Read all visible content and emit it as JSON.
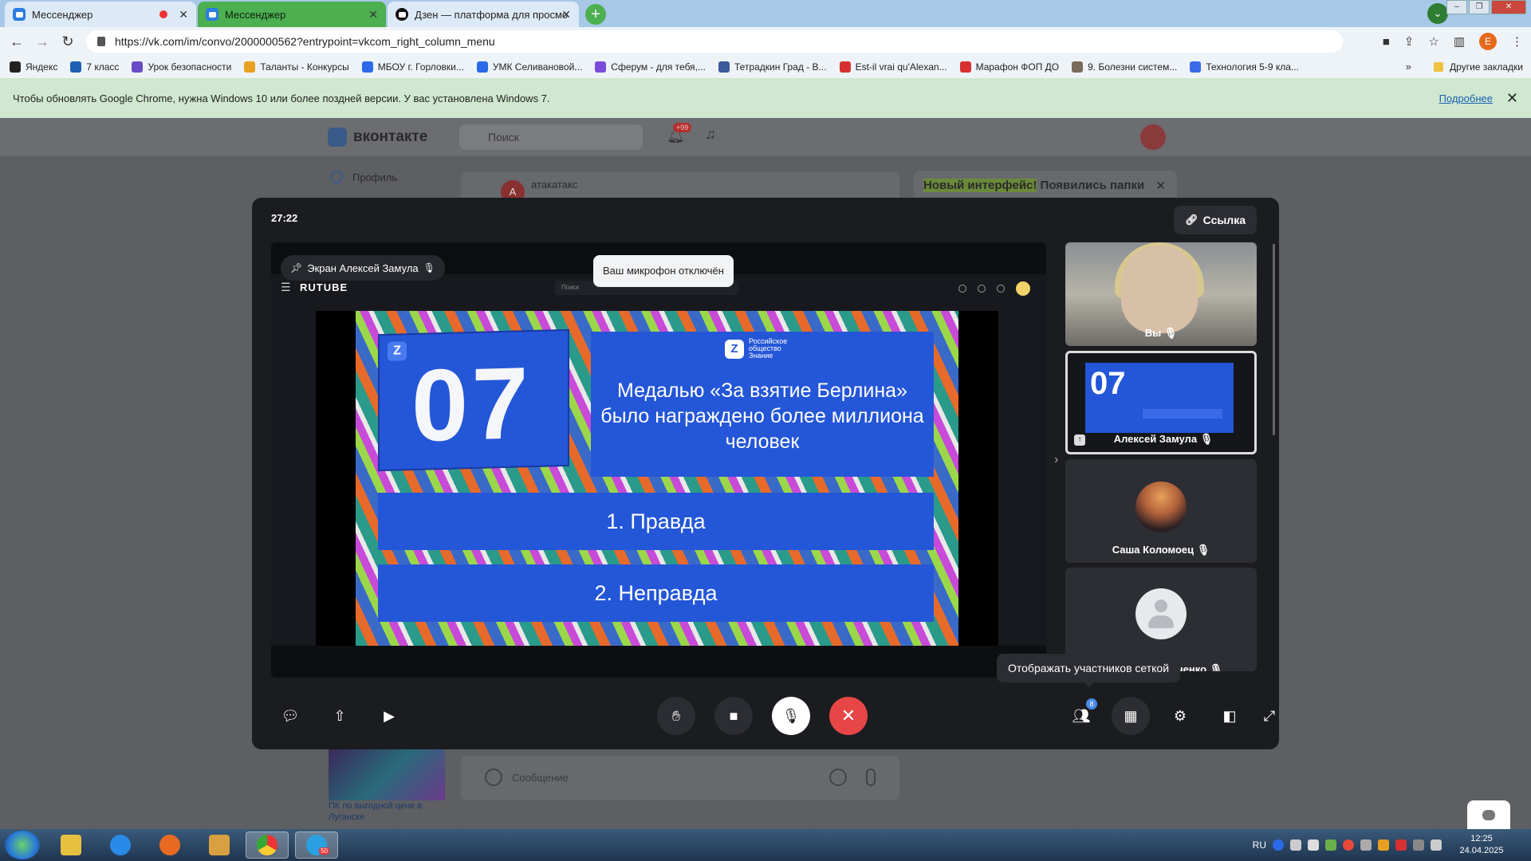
{
  "browser": {
    "tabs": [
      {
        "title": "Мессенджер"
      },
      {
        "title": "Мессенджер"
      },
      {
        "title": "Дзен — платформа для просмо"
      }
    ],
    "url": "https://vk.com/im/convo/2000000562?entrypoint=vkcom_right_column_menu",
    "profile_initial": "E",
    "bookmarks": [
      {
        "label": "Яндекс",
        "color": "#222222"
      },
      {
        "label": "7 класс",
        "color": "#1f5fb4"
      },
      {
        "label": "Урок безопасности",
        "color": "#6a4ac8"
      },
      {
        "label": "Таланты - Конкурсы",
        "color": "#e8a020"
      },
      {
        "label": "МБОУ г. Горловки...",
        "color": "#2a6ae8"
      },
      {
        "label": "УМК Селивановой...",
        "color": "#2a6ae8"
      },
      {
        "label": "Сферум - для тебя,...",
        "color": "#7a4ad8"
      },
      {
        "label": "Тетрадкин Град - В...",
        "color": "#3a5a9a"
      },
      {
        "label": "Est-il vrai qu'Alexan...",
        "color": "#d83030"
      },
      {
        "label": "Марафон ФОП ДО",
        "color": "#d83030"
      },
      {
        "label": "9. Болезни систем...",
        "color": "#7a6a5a"
      },
      {
        "label": "Технология 5-9 кла...",
        "color": "#3a6ae8"
      }
    ],
    "bookmarks_more": "»",
    "other_bookmarks": "Другие закладки"
  },
  "infobar": {
    "text": "Чтобы обновлять Google Chrome, нужна Windows 10 или более поздней версии. У вас установлена Windows 7.",
    "link": "Подробнее"
  },
  "vk": {
    "logo": "вконтакте",
    "search_placeholder": "Поиск",
    "notif_badge": "+99",
    "profile_item": "Профиль",
    "chat_name": "атакатакс",
    "chat_avatar_letter": "А",
    "new_ui_highlight": "Новый интерфейс!",
    "new_ui_text": " Появились папки",
    "message_placeholder": "Сообщение",
    "ad_text": "ПК по выгодной цене в Луганске"
  },
  "call": {
    "timer": "27:22",
    "link_button": "Ссылка",
    "screen_label": "Экран Алексей Замула",
    "mic_toast": "Ваш микрофон отключён",
    "participants_count": "8",
    "grid_tooltip": "Отображать участников сеткой",
    "participants": [
      {
        "name": "Вы"
      },
      {
        "name": "Алексей Замула"
      },
      {
        "name": "Саша Коломоец"
      },
      {
        "name": "Анна Мирошниченко"
      }
    ]
  },
  "rutube": {
    "logo": "RUTUBE",
    "search_placeholder": "Поиск"
  },
  "slide": {
    "number": "07",
    "org": "Российское общество Знание",
    "question": "Медалью «За взятие Берлина» было награждено более миллиона человек",
    "answers": [
      "1. Правда",
      "2. Неправда"
    ]
  },
  "taskbar": {
    "lang": "RU",
    "time": "12:25",
    "date": "24.04.2025",
    "telegram_badge": "50"
  },
  "colors": {
    "slide_blue": "#2456d8",
    "hangup_red": "#e64646",
    "call_bg": "#1b1c20"
  }
}
